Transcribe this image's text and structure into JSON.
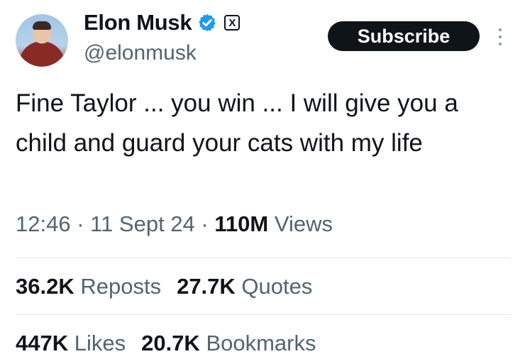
{
  "author": {
    "display_name": "Elon Musk",
    "handle": "@elonmusk",
    "verified_icon": "verified-badge-icon",
    "affiliation_icon": "x-logo-icon",
    "x_glyph": "X"
  },
  "actions": {
    "subscribe_label": "Subscribe",
    "more_icon": "more-vertical-icon"
  },
  "tweet": {
    "text": "Fine Taylor ... you win ... I will give you a child and guard your cats with my life"
  },
  "meta": {
    "time": "12:46",
    "sep1": " · ",
    "date": "11 Sept 24",
    "sep2": " · ",
    "views_count": "110M",
    "views_label": " Views"
  },
  "stats": {
    "reposts_count": "36.2K",
    "reposts_label": " Reposts",
    "quotes_count": "27.7K",
    "quotes_label": " Quotes",
    "likes_count": "447K",
    "likes_label": " Likes",
    "bookmarks_count": "20.7K",
    "bookmarks_label": " Bookmarks"
  },
  "colors": {
    "text_primary": "#0f1419",
    "text_secondary": "#536471",
    "verified_blue": "#1d9bf0",
    "button_bg": "#0f1419"
  }
}
